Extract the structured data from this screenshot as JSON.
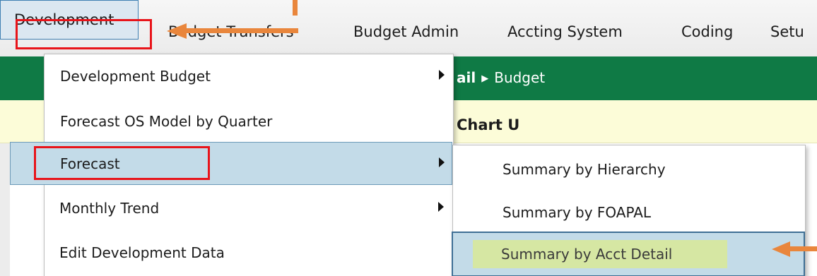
{
  "menubar": {
    "items": [
      {
        "label": "Development"
      },
      {
        "label": "Budget Transfers"
      },
      {
        "label": "Budget Admin"
      },
      {
        "label": "Accting System"
      },
      {
        "label": "Coding"
      },
      {
        "label": "Setu"
      }
    ]
  },
  "breadcrumb": {
    "prefix": "ail",
    "current": "Budget"
  },
  "background": {
    "chart_label": "Chart U"
  },
  "development_menu": {
    "items": [
      {
        "label": "Development Budget",
        "has_submenu": true
      },
      {
        "label": "Forecast OS Model by Quarter",
        "has_submenu": false
      },
      {
        "label": "Forecast",
        "has_submenu": true
      },
      {
        "label": "Monthly Trend",
        "has_submenu": true
      },
      {
        "label": "Edit Development Data",
        "has_submenu": false
      }
    ]
  },
  "forecast_submenu": {
    "items": [
      {
        "label": "Summary by Hierarchy"
      },
      {
        "label": "Summary by FOAPAL"
      },
      {
        "label": "Summary by Acct Detail"
      }
    ]
  },
  "colors": {
    "green_bar": "#0f7a45",
    "highlight_blue": "#c3dbe8",
    "yellow_band": "#fcfcd8",
    "annotation_red": "#e8141a",
    "annotation_orange": "#e9863c",
    "acct_highlight": "#d6e7a3"
  },
  "icons": {
    "submenu_arrow": "caret-right-icon",
    "breadcrumb_separator": "breadcrumb-arrow-icon"
  }
}
